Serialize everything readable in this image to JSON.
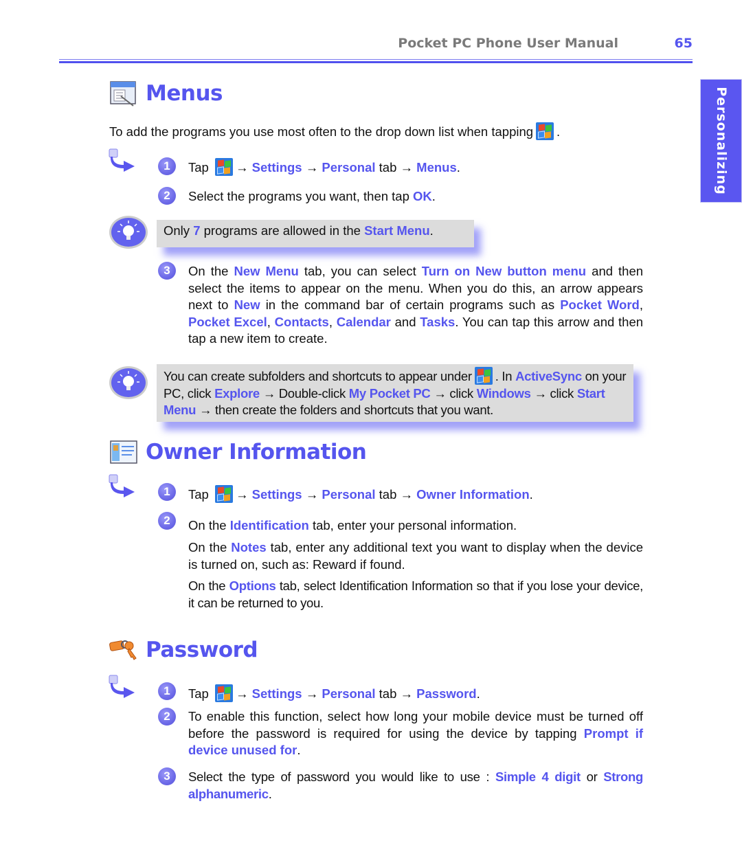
{
  "header": {
    "title": "Pocket PC Phone User Manual",
    "page_number": "65"
  },
  "side_tab": {
    "label": "Personalizing"
  },
  "colors": {
    "accent": "#5555ee",
    "header_gray": "#7a7a7a",
    "tip_bg": "#dcdcdc",
    "side_tab": "#5a56f0"
  },
  "icons": {
    "step_arrow": "step-arrow-icon",
    "start_flag": "windows-start-flag-icon",
    "tip": "lightbulb-tip-icon",
    "menus": "menus-window-icon",
    "owner": "owner-card-icon",
    "password": "keys-icon"
  },
  "menus": {
    "title": "Menus",
    "intro": "To add the programs you use most often to the drop down list when tapping",
    "steps": [
      {
        "num": "1",
        "parts": [
          "Tap",
          "→",
          "Settings",
          "→",
          "Personal",
          "tab →",
          "Menus",
          "."
        ]
      },
      {
        "num": "2",
        "parts": [
          "Select the programs you want, then tap",
          "OK",
          "."
        ]
      }
    ],
    "tip1": {
      "a": "Only",
      "b": "7",
      "c": "programs are allowed in the",
      "d": "Start Menu",
      "e": "."
    },
    "step3": {
      "num": "3",
      "p1": "On the",
      "p2": "New Menu",
      "p3": "tab, you can select",
      "p4": "Turn on New button menu",
      "p5": "and then select the items to appear on the menu.  When you do this, an arrow appears next to",
      "p6": "New",
      "p7": "in the command bar of certain programs such as",
      "p8": "Pocket Word",
      "p9": ",",
      "p10": "Pocket Excel",
      "p11": ",",
      "p12": "Contacts",
      "p13": ",",
      "p14": "Calendar",
      "p15": "and",
      "p16": "Tasks",
      "p17": ".  You can tap this arrow and then tap a new item to create."
    },
    "tip2": {
      "a": "You can create subfolders and shortcuts to appear under",
      "b": ".  In",
      "c": "ActiveSync",
      "d": "on your PC, click",
      "e": "Explore",
      "f": "→ Double-click",
      "g": "My Pocket PC",
      "h": "→ click",
      "i": "Windows",
      "j": "→ click",
      "k": "Start Menu",
      "l": "→ then create the folders and shortcuts that you want."
    }
  },
  "owner": {
    "title": "Owner Information",
    "step1": {
      "num": "1",
      "parts": [
        "Tap",
        "→",
        "Settings",
        "→",
        "Personal",
        "tab →",
        "Owner Information",
        "."
      ]
    },
    "step2": {
      "num": "2",
      "a": "On the",
      "b": "Identification",
      "c": "tab, enter your personal information."
    },
    "notes": {
      "a": "On the",
      "b": "Notes",
      "c": "tab, enter any additional text you want to display when the device is turned on, such as: Reward if found."
    },
    "options": {
      "a": "On the",
      "b": "Options",
      "c": "tab, select Identification Information so that if you lose your device, it can be returned to you."
    }
  },
  "password": {
    "title": "Password",
    "step1": {
      "num": "1",
      "parts": [
        "Tap",
        "→",
        "Settings",
        "→",
        "Personal",
        "tab →",
        "Password",
        "."
      ]
    },
    "step2": {
      "num": "2",
      "a": "To enable this function, select how long your mobile device must be turned off before the password is required for using the device by tapping",
      "b": "Prompt if device unused for",
      "c": "."
    },
    "step3": {
      "num": "3",
      "a": "Select the type of password you would like to use :",
      "b": "Simple 4 digit",
      "c": "or",
      "d": "Strong alphanumeric",
      "e": "."
    }
  }
}
